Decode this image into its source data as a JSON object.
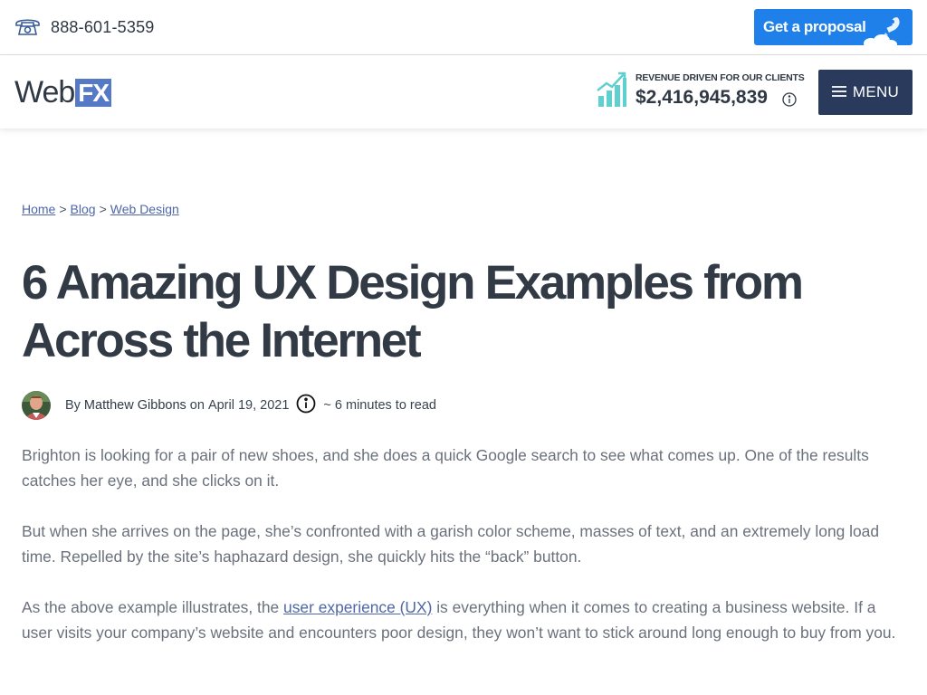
{
  "topbar": {
    "phone_number": "888-601-5359",
    "phone_icon": "phone-icon",
    "proposal_label": "Get a proposal",
    "proposal_icon": "rocket-icon"
  },
  "header": {
    "logo": {
      "word": "Web",
      "badge": "FX"
    },
    "revenue": {
      "label": "REVENUE DRIVEN FOR OUR CLIENTS",
      "value": "$2,416,945,839",
      "icon": "growth-chart-icon"
    },
    "menu_label": "MENU"
  },
  "breadcrumb": {
    "items": [
      "Home",
      "Blog",
      "Web Design"
    ],
    "separator": ">"
  },
  "article": {
    "title": "6 Amazing UX Design Examples from Across the Internet",
    "meta": {
      "by": "By",
      "author": "Matthew Gibbons",
      "on": "on",
      "date": "April 19, 2021",
      "read_time": "~ 6 minutes to read"
    },
    "paragraphs": [
      {
        "text": "Brighton is looking for a pair of new shoes, and she does a quick Google search to see what comes up. One of the results catches her eye, and she clicks on it."
      },
      {
        "text": "But when she arrives on the page, she’s confronted with a garish color scheme, masses of text, and an extremely long load time. Repelled by the site’s haphazard design, she quickly hits the “back” button."
      },
      {
        "before": "As the above example illustrates, the ",
        "link": "user experience (UX)",
        "after": " is everything when it comes to creating a business website. If a user visits your company’s website and encounters poor design, they won’t want to stick around long enough to buy from you."
      }
    ]
  },
  "colors": {
    "accent_blue": "#1e80e8",
    "menu_navy": "#2a3a5c",
    "logo_badge": "#5579c6",
    "link": "#4d67a8",
    "growth_teal": "#5fd0cf"
  }
}
